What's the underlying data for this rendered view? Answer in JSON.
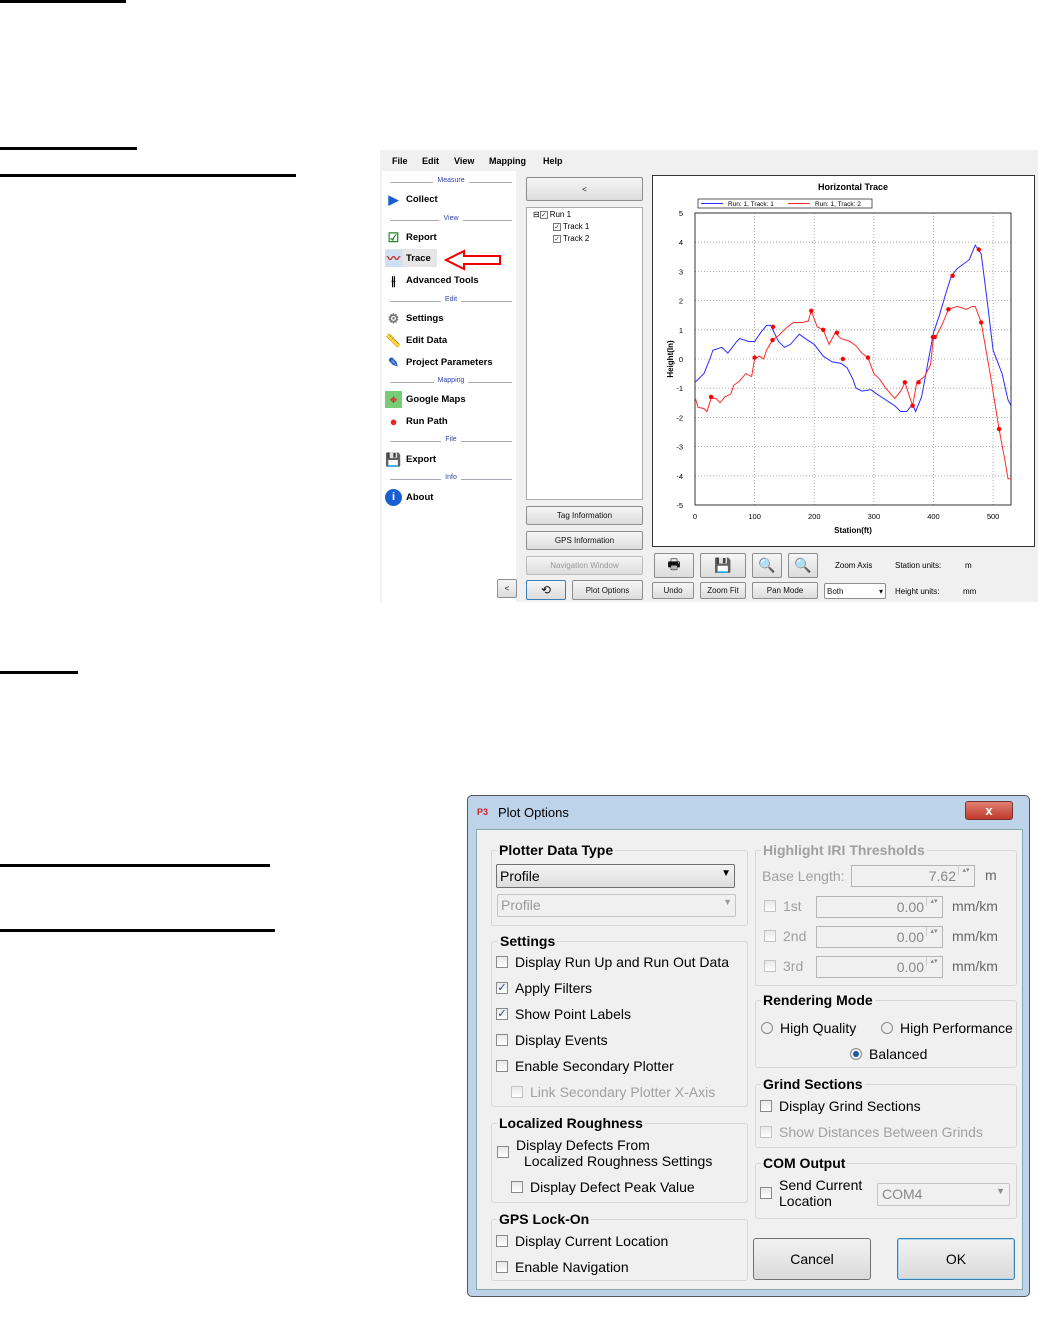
{
  "app": {
    "menu": [
      "File",
      "Edit",
      "View",
      "Mapping",
      "Help"
    ],
    "nav": {
      "sections": {
        "measure": "Measure",
        "view": "View",
        "edit": "Edit",
        "mapping": "Mapping",
        "file": "File",
        "info": "Info"
      },
      "items": {
        "collect": "Collect",
        "report": "Report",
        "trace": "Trace",
        "advanced": "Advanced Tools",
        "settings": "Settings",
        "edit_data": "Edit Data",
        "project": "Project Parameters",
        "google": "Google Maps",
        "run_path": "Run Path",
        "export": "Export",
        "about": "About"
      }
    },
    "collapse_label": "<",
    "tree": {
      "run": "Run 1",
      "tracks": [
        "Track 1",
        "Track 2"
      ]
    },
    "buttons": {
      "tag": "Tag Information",
      "gps": "GPS Information",
      "nav_window": "Navigation Window",
      "plot_options": "Plot Options",
      "back": "<",
      "undo": "Undo",
      "zoom_fit": "Zoom Fit",
      "pan_mode": "Pan Mode"
    },
    "toolbar": {
      "zoom_axis": "Zoom Axis",
      "zoom_axis_value": "Both",
      "station_units_label": "Station units:",
      "station_units": "m",
      "height_units_label": "Height units:",
      "height_units": "mm"
    }
  },
  "chart_data": {
    "type": "line",
    "title": "Horizontal Trace",
    "xlabel": "Station(ft)",
    "ylabel": "Height(In)",
    "xlim": [
      0,
      530
    ],
    "ylim": [
      -5,
      5
    ],
    "xticks": [
      0,
      100,
      200,
      300,
      400,
      500
    ],
    "yticks": [
      5,
      4,
      3,
      2,
      1,
      0,
      -1,
      -2,
      -3,
      -4,
      -5
    ],
    "grid": true,
    "legend": "top",
    "series": [
      {
        "name": "Run: 1, Track: 1",
        "color": "#2b2bff",
        "x": [
          0,
          15,
          25,
          30,
          45,
          55,
          70,
          75,
          90,
          100,
          110,
          120,
          127,
          140,
          150,
          160,
          175,
          185,
          200,
          215,
          230,
          245,
          255,
          265,
          270,
          280,
          295,
          305,
          320,
          335,
          345,
          355,
          365,
          370,
          380,
          390,
          400,
          410,
          420,
          430,
          440,
          460,
          470,
          480,
          490,
          500,
          515,
          525,
          530
        ],
        "y": [
          -0.8,
          -0.5,
          0,
          0.3,
          0.4,
          0.2,
          0.6,
          0.7,
          0.6,
          0.6,
          0.9,
          1.15,
          1.15,
          0.6,
          0.4,
          0.5,
          0.85,
          0.7,
          0.5,
          0.1,
          -0.1,
          -0.15,
          -0.3,
          -0.7,
          -1,
          -1.1,
          -1.05,
          -1.2,
          -1.4,
          -1.6,
          -1.8,
          -1.8,
          -1.55,
          -1.8,
          -1.3,
          -0.2,
          0.9,
          1.5,
          2.2,
          2.85,
          3.1,
          3.4,
          3.9,
          3.6,
          2,
          0.3,
          -0.5,
          -1.4,
          -1.6
        ]
      },
      {
        "name": "Run: 1, Track: 2",
        "color": "#ff2b2b",
        "x": [
          0,
          5,
          15,
          20,
          27,
          35,
          42,
          50,
          60,
          65,
          75,
          85,
          95,
          100,
          108,
          115,
          120,
          130,
          140,
          150,
          155,
          165,
          180,
          190,
          195,
          205,
          215,
          225,
          235,
          245,
          260,
          270,
          280,
          290,
          300,
          310,
          320,
          335,
          345,
          352,
          360,
          365,
          372,
          385,
          395,
          400,
          405,
          415,
          425,
          440,
          455,
          465,
          470,
          480,
          495,
          510,
          520,
          525,
          530
        ],
        "y": [
          -1.3,
          -1.65,
          -1.7,
          -1.8,
          -1.35,
          -1.35,
          -1.5,
          -1.3,
          -1.2,
          -0.9,
          -0.75,
          -0.5,
          -0.6,
          0,
          0.1,
          0,
          0.3,
          0.65,
          0.8,
          1.0,
          1.1,
          1.25,
          1.25,
          1.3,
          1.65,
          1.1,
          1.0,
          0.5,
          0.9,
          0.7,
          0.6,
          0.45,
          0.2,
          0.05,
          -0.5,
          -0.7,
          -1.0,
          -1.35,
          -1.1,
          -0.8,
          -1.3,
          -1.6,
          -0.8,
          -0.6,
          -0.2,
          0.75,
          0.8,
          1.2,
          1.7,
          1.8,
          1.7,
          1.8,
          1.8,
          1.25,
          -0.5,
          -2.4,
          -3.5,
          -4.1,
          -4.1
        ]
      }
    ],
    "point_labels": {
      "color": "#ff0000",
      "x": [
        27,
        100,
        130,
        131,
        195,
        215,
        238,
        248,
        290,
        352,
        365,
        375,
        399,
        402,
        425,
        432,
        476,
        480,
        510
      ],
      "y": [
        -1.3,
        0.05,
        0.65,
        1.1,
        1.65,
        1.0,
        0.9,
        0,
        0.05,
        -0.8,
        -1.6,
        -0.8,
        0.75,
        0.75,
        1.7,
        2.85,
        3.75,
        1.25,
        -2.4
      ]
    }
  },
  "dialog": {
    "title": "Plot Options",
    "close": "x",
    "plotter_data_type": {
      "title": "Plotter Data Type",
      "value": "Profile",
      "secondary_value": "Profile"
    },
    "settings": {
      "title": "Settings",
      "items": [
        {
          "label": "Display Run Up and Run Out Data",
          "checked": false
        },
        {
          "label": "Apply Filters",
          "checked": true
        },
        {
          "label": "Show Point Labels",
          "checked": true
        },
        {
          "label": "Display Events",
          "checked": false
        },
        {
          "label": "Enable Secondary Plotter",
          "checked": false
        },
        {
          "label": "Link Secondary Plotter X-Axis",
          "checked": false
        }
      ]
    },
    "localized": {
      "title": "Localized Roughness",
      "defects_line1": "Display Defects From",
      "defects_line2": "Localized Roughness Settings",
      "peak": "Display Defect Peak Value"
    },
    "gps": {
      "title": "GPS Lock-On",
      "current": "Display Current Location",
      "navigation": "Enable Navigation"
    },
    "iri": {
      "title": "Highlight IRI Thresholds",
      "base_label": "Base Length:",
      "base_value": "7.62",
      "base_unit": "m",
      "thresholds": [
        {
          "label": "1st",
          "value": "0.00",
          "unit": "mm/km"
        },
        {
          "label": "2nd",
          "value": "0.00",
          "unit": "mm/km"
        },
        {
          "label": "3rd",
          "value": "0.00",
          "unit": "mm/km"
        }
      ]
    },
    "rendering": {
      "title": "Rendering Mode",
      "high_quality": "High Quality",
      "high_performance": "High Performance",
      "balanced": "Balanced",
      "selected": "Balanced"
    },
    "grind": {
      "title": "Grind Sections",
      "display": "Display Grind Sections",
      "distances": "Show Distances Between Grinds"
    },
    "com": {
      "title": "COM Output",
      "send_line1": "Send Current",
      "send_line2": "Location",
      "port": "COM4"
    },
    "cancel": "Cancel",
    "ok": "OK"
  }
}
